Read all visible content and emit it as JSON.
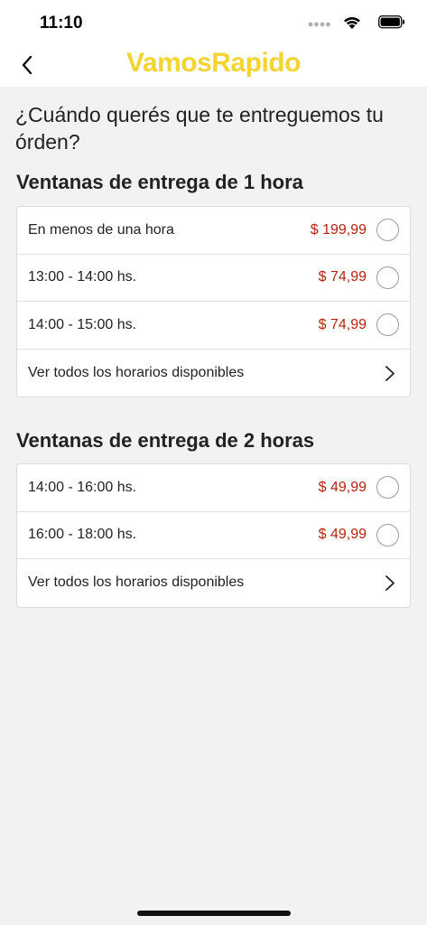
{
  "status_bar": {
    "time": "11:10"
  },
  "nav": {
    "logo": "VamosRapido"
  },
  "question": "¿Cuándo querés que te entreguemos tu órden?",
  "sections": [
    {
      "title": "Ventanas de entrega de 1 hora",
      "rows": [
        {
          "label": "En menos de una hora",
          "price": "$ 199,99"
        },
        {
          "label": "13:00 - 14:00 hs.",
          "price": "$ 74,99"
        },
        {
          "label": "14:00 - 15:00 hs.",
          "price": "$ 74,99"
        }
      ],
      "see_all": "Ver todos los horarios disponibles"
    },
    {
      "title": "Ventanas de entrega de 2 horas",
      "rows": [
        {
          "label": "14:00 - 16:00 hs.",
          "price": "$ 49,99"
        },
        {
          "label": "16:00 - 18:00 hs.",
          "price": "$ 49,99"
        }
      ],
      "see_all": "Ver todos los horarios disponibles"
    }
  ],
  "colors": {
    "logo": "#f4d430",
    "price": "#b5230f",
    "background": "#f2f2f2"
  },
  "icons": [
    "back-chevron-icon",
    "wifi-icon",
    "battery-icon",
    "signal-icon",
    "radio-icon",
    "chevron-right-icon"
  ]
}
